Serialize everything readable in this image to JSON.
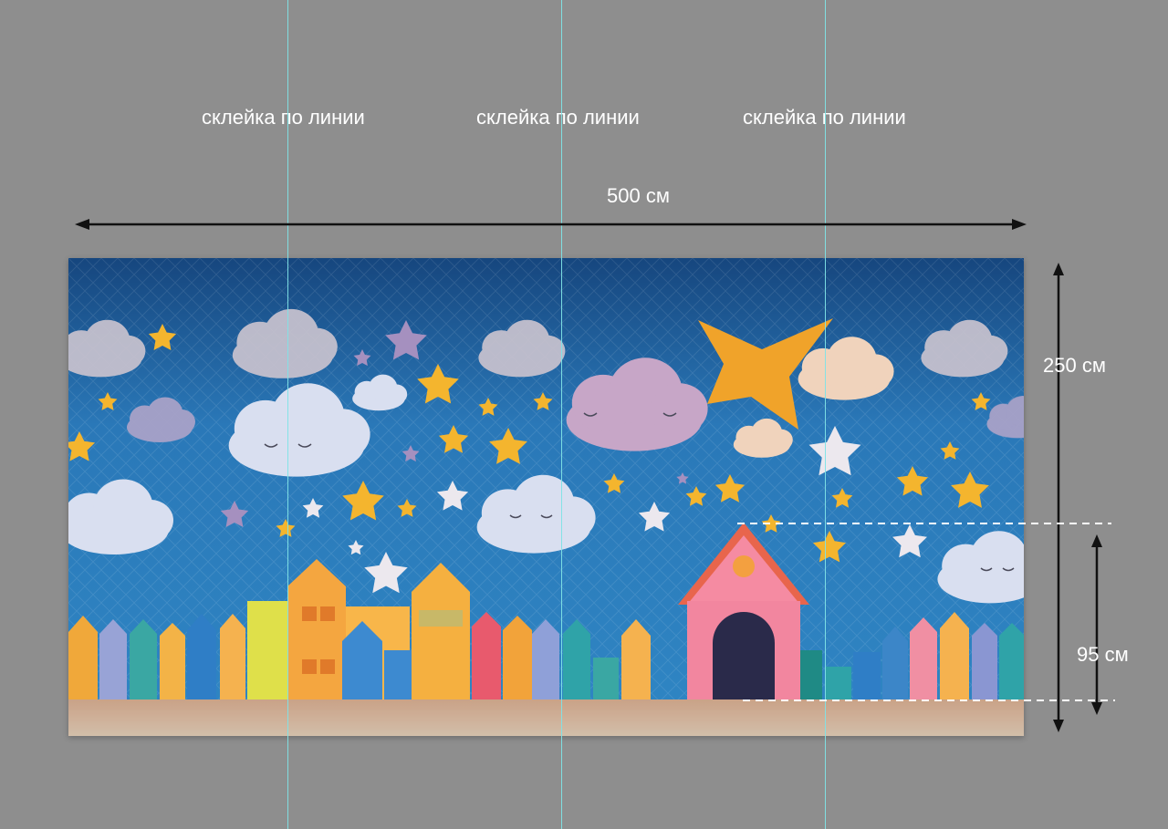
{
  "seam_labels": [
    "склейка по линии",
    "склейка по линии",
    "склейка по линии"
  ],
  "width_label": "500 см",
  "height_label": "250 см",
  "house_height_label": "95 см",
  "colors": {
    "background": "#8e8e8e",
    "seam_line": "#7fe3e6",
    "sky": "#1f6fb0",
    "arrow": "#111111",
    "dashed": "#ffffff"
  }
}
